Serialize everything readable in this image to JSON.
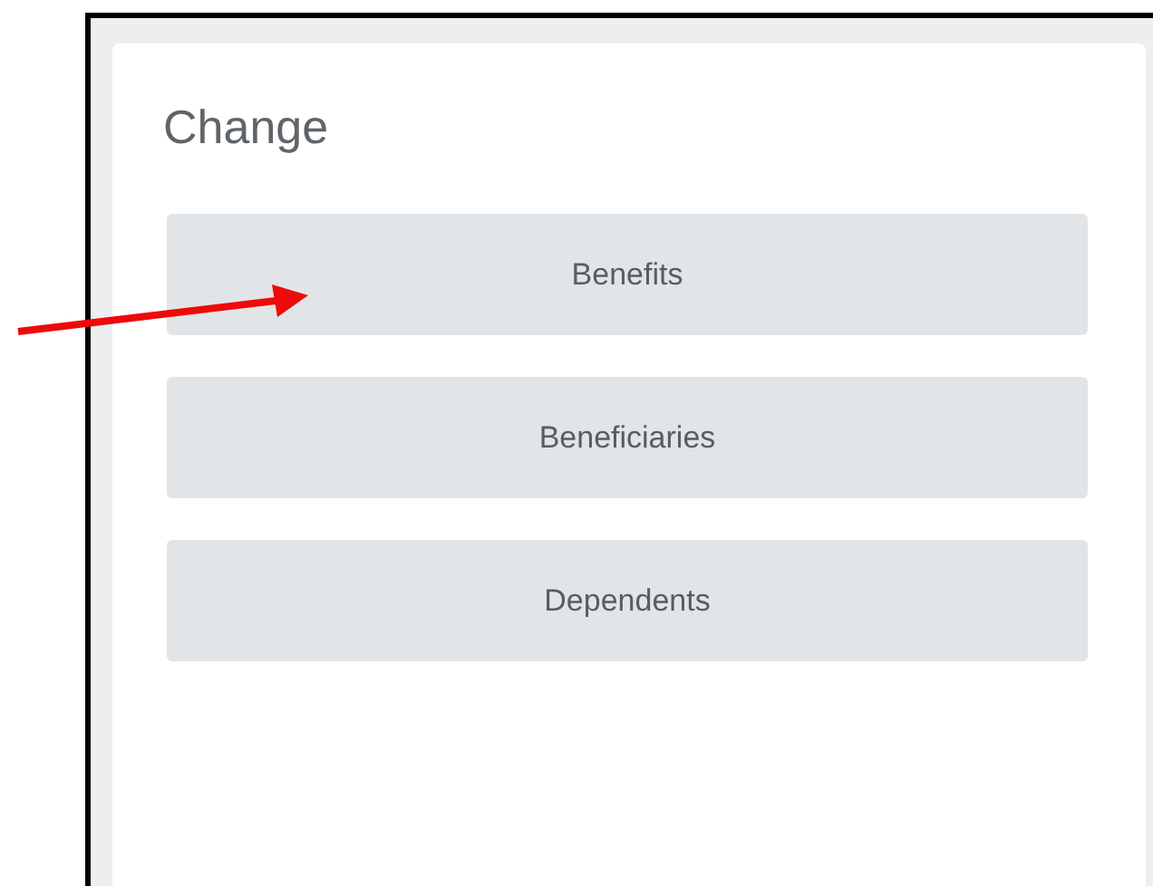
{
  "title": "Change",
  "buttons": [
    "Benefits",
    "Beneficiaries",
    "Dependents"
  ]
}
